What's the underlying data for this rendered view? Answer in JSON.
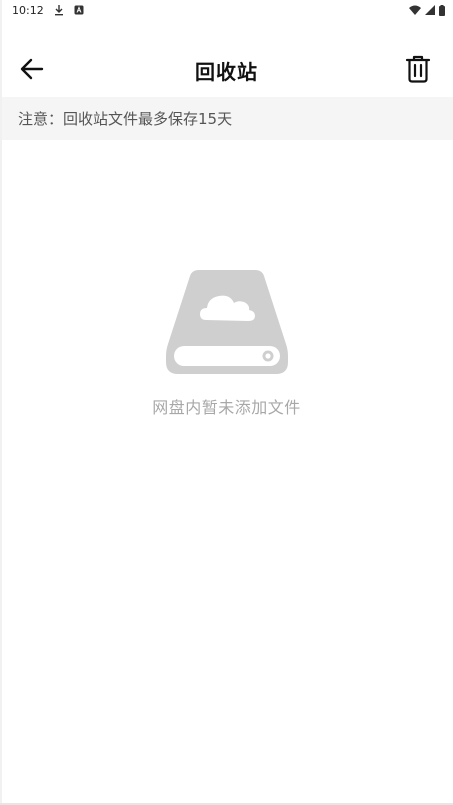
{
  "status_bar": {
    "time": "10:12",
    "left_icons": [
      "download-icon",
      "keyboard-a-icon"
    ],
    "right_icons": [
      "wifi-icon",
      "cellular-signal-icon",
      "battery-icon"
    ]
  },
  "header": {
    "title": "回收站",
    "back_icon": "arrow-left-icon",
    "action_icon": "trash-icon"
  },
  "notice": {
    "text": "注意：回收站文件最多保存15天"
  },
  "empty_state": {
    "illustration_icon": "cloud-drive-icon",
    "message": "网盘内暂未添加文件"
  },
  "colors": {
    "notice_background": "#f5f5f5",
    "illustration": "#cfcfcf",
    "empty_text": "#a8a8a8",
    "title": "#111111"
  }
}
